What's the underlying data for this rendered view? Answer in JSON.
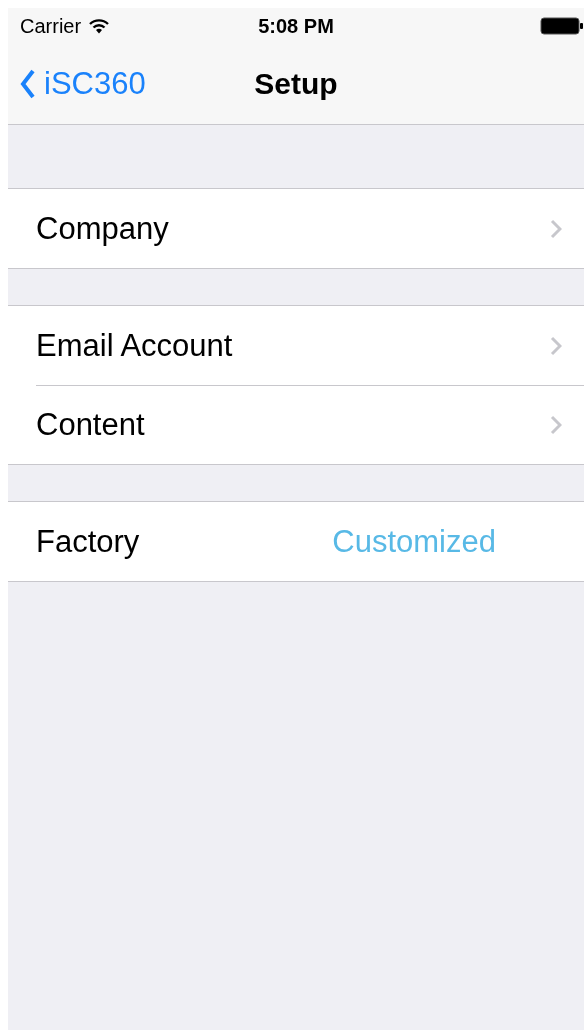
{
  "status_bar": {
    "carrier": "Carrier",
    "time": "5:08 PM"
  },
  "nav": {
    "back": "iSC360",
    "title": "Setup"
  },
  "sections": [
    {
      "rows": [
        {
          "kind": "disclosure",
          "label": "Company"
        }
      ]
    },
    {
      "rows": [
        {
          "kind": "disclosure",
          "label": "Email Account"
        },
        {
          "kind": "disclosure",
          "label": "Content"
        }
      ]
    },
    {
      "rows": [
        {
          "kind": "value",
          "label": "Factory",
          "value": "Customized"
        }
      ]
    }
  ]
}
